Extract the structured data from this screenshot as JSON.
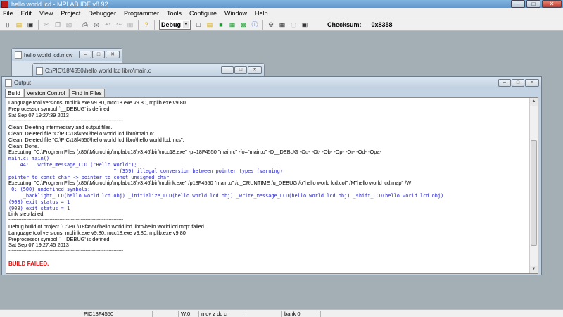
{
  "window": {
    "title": "hello world lcd - MPLAB IDE v8.92"
  },
  "menu": [
    "File",
    "Edit",
    "View",
    "Project",
    "Debugger",
    "Programmer",
    "Tools",
    "Configure",
    "Window",
    "Help"
  ],
  "toolbar": {
    "build_config": "Debug",
    "checksum_label": "Checksum:",
    "checksum_value": "0x8358"
  },
  "workspace_window": {
    "title": "hello world lcd.mcw"
  },
  "editor_window": {
    "title": "C:\\PIC\\18f4550\\hello world lcd libro\\main.c"
  },
  "output_window": {
    "title": "Output",
    "tabs": [
      "Build",
      "Version Control",
      "Find in Files"
    ],
    "active_tab": "Build",
    "lines": [
      {
        "text": "Language tool versions: mplink.exe v9.80, mcc18.exe v9.80, mplib.exe v9.80",
        "style": "normal"
      },
      {
        "text": "Preprocessor symbol `__DEBUG' is defined.",
        "style": "normal"
      },
      {
        "text": "Sat Sep 07 19:27:39 2013",
        "style": "normal"
      },
      {
        "text": "----------------------------------------------------------------------",
        "style": "rule"
      },
      {
        "text": "Clean: Deleting intermediary and output files.",
        "style": "normal"
      },
      {
        "text": "Clean: Deleted file \"C:\\PIC\\18f4550\\hello world lcd libro\\main.o\".",
        "style": "normal"
      },
      {
        "text": "Clean: Deleted file \"C:\\PIC\\18f4550\\hello world lcd libro\\hello world lcd.mcs\".",
        "style": "normal"
      },
      {
        "text": "Clean: Done.",
        "style": "normal"
      },
      {
        "text": "Executing: \"C:\\Program Files (x86)\\Microchip\\mplabc18\\v3.46\\bin\\mcc18.exe\" -p=18F4550 \"main.c\" -fo=\"main.o\" -D__DEBUG -Ou- -Ot- -Ob- -Op- -Or- -Od- -Opa-",
        "style": "normal"
      },
      {
        "text": "main.c: main()",
        "style": "mono"
      },
      {
        "text": "    44:   write_message_LCD (\"Hello World\");",
        "style": "mono"
      },
      {
        "text": "                                    ^ (359) illegal conversion between pointer types (warning)",
        "style": "mono"
      },
      {
        "text": "pointer to const char -> pointer to const unsigned char",
        "style": "mono"
      },
      {
        "text": "Executing: \"C:\\Program Files (x86)\\Microchip\\mplabc18\\v3.46\\bin\\mplink.exe\" /p18F4550 \"main.o\" /u_CRUNTIME /u_DEBUG /o\"hello world lcd.cof\" /M\"hello world lcd.map\" /W",
        "style": "normal"
      },
      {
        "text": " 0: (500) undefined symbols:",
        "style": "mono"
      },
      {
        "text": "     _backlight_LCD(hello world lcd.obj) _initialize_LCD(hello world lcd.obj) _write_message_LCD(hello world lcd.obj) _shift_LCD(hello world lcd.obj)",
        "style": "mono"
      },
      {
        "text": "(908) exit status = 1",
        "style": "mono"
      },
      {
        "text": "(908) exit status = 1",
        "style": "mono"
      },
      {
        "text": "Link step failed.",
        "style": "normal"
      },
      {
        "text": "----------------------------------------------------------------------",
        "style": "rule"
      },
      {
        "text": "Debug build of project `C:\\PIC\\18f4550\\hello world lcd libro\\hello world lcd.mcp' failed.",
        "style": "normal"
      },
      {
        "text": "Language tool versions: mplink.exe v9.80, mcc18.exe v9.80, mplib.exe v9.80",
        "style": "normal"
      },
      {
        "text": "Preprocessor symbol `__DEBUG' is defined.",
        "style": "normal"
      },
      {
        "text": "Sat Sep 07 19:27:45 2013",
        "style": "normal"
      },
      {
        "text": "----------------------------------------------------------------------",
        "style": "rule"
      },
      {
        "text": "",
        "style": "normal"
      },
      {
        "text": "BUILD FAILED.",
        "style": "red"
      }
    ]
  },
  "status_bar": {
    "device": "PIC18F4550",
    "wreg": "W:0",
    "flags": "n ov z dc c",
    "bank": "bank 0"
  },
  "colors": {
    "error_text": "#e01010",
    "compiler_text": "#2424c8",
    "desktop_bg": "#a3aeb5"
  }
}
